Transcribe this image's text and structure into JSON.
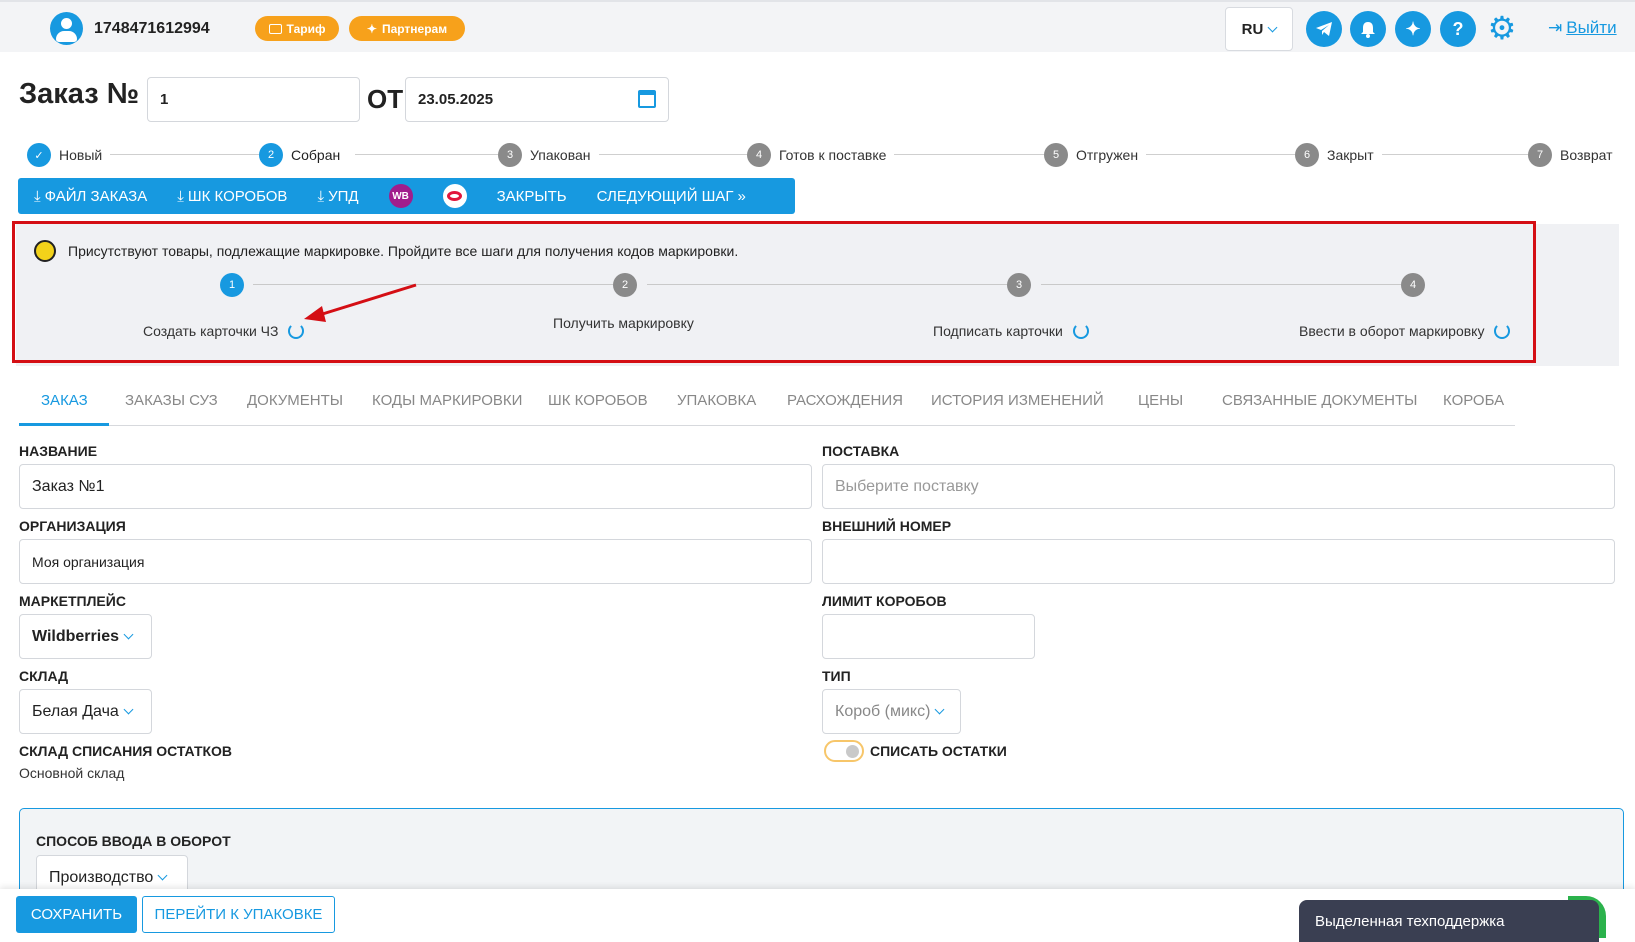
{
  "header": {
    "user_id": "1748471612994",
    "tariff_label": "Тариф",
    "partners_label": "Партнерам",
    "language": "RU",
    "logout_label": "Выйти"
  },
  "order": {
    "title": "Заказ №",
    "number": "1",
    "from_label": "ОТ",
    "date": "23.05.2025"
  },
  "status_steps": [
    {
      "num": "✓",
      "label": "Новый",
      "state": "done"
    },
    {
      "num": "2",
      "label": "Собран",
      "state": "current"
    },
    {
      "num": "3",
      "label": "Упакован",
      "state": "todo"
    },
    {
      "num": "4",
      "label": "Готов к поставке",
      "state": "todo"
    },
    {
      "num": "5",
      "label": "Отгружен",
      "state": "todo"
    },
    {
      "num": "6",
      "label": "Закрыт",
      "state": "todo"
    },
    {
      "num": "7",
      "label": "Возврат",
      "state": "todo"
    }
  ],
  "actions": {
    "order_file": "ФАЙЛ ЗАКАЗА",
    "box_barcodes": "ШК КОРОБОВ",
    "upd": "УПД",
    "wb": "WB",
    "close": "ЗАКРЫТЬ",
    "next_step": "СЛЕДУЮЩИЙ ШАГ"
  },
  "marking": {
    "notice": "Присутствуют товары, подлежащие маркировке. Пройдите все шаги для получения кодов маркировки.",
    "steps": [
      {
        "num": "1",
        "label": "Создать карточки ЧЗ"
      },
      {
        "num": "2",
        "label": "Получить маркировку"
      },
      {
        "num": "3",
        "label": "Подписать карточки"
      },
      {
        "num": "4",
        "label": "Ввести в оборот маркировку"
      }
    ]
  },
  "tabs": [
    "ЗАКАЗ",
    "ЗАКАЗЫ СУЗ",
    "ДОКУМЕНТЫ",
    "КОДЫ МАРКИРОВКИ",
    "ШК КОРОБОВ",
    "УПАКОВКА",
    "РАСХОЖДЕНИЯ",
    "ИСТОРИЯ ИЗМЕНЕНИЙ",
    "ЦЕНЫ",
    "СВЯЗАННЫЕ ДОКУМЕНТЫ",
    "КОРОБА"
  ],
  "form": {
    "name_label": "НАЗВАНИЕ",
    "name_value": "Заказ №1",
    "supply_label": "ПОСТАВКА",
    "supply_placeholder": "Выберите поставку",
    "org_label": "ОРГАНИЗАЦИЯ",
    "org_value": "Моя организация",
    "ext_label": "ВНЕШНИЙ НОМЕР",
    "ext_value": "",
    "mp_label": "МАРКЕТПЛЕЙС",
    "mp_value": "Wildberries",
    "box_limit_label": "ЛИМИТ КОРОБОВ",
    "box_limit_value": "",
    "wh_label": "СКЛАД",
    "wh_value": "Белая Дача",
    "type_label": "ТИП",
    "type_value": "Короб (микс)",
    "writeoff_wh_label": "СКЛАД СПИСАНИЯ ОСТАТКОВ",
    "writeoff_wh_value": "Основной склад",
    "writeoff_toggle_label": "СПИСАТЬ ОСТАТКИ",
    "circulation_label": "СПОСОБ ВВОДА В ОБОРОТ",
    "circulation_value": "Производство"
  },
  "footer": {
    "save": "СОХРАНИТЬ",
    "go_pack": "ПЕРЕЙТИ К УПАКОВКЕ",
    "support": "Выделенная техподдержка"
  },
  "colors": {
    "accent": "#1799e0",
    "orange": "#f7a11b",
    "highlight": "#d40e14"
  }
}
